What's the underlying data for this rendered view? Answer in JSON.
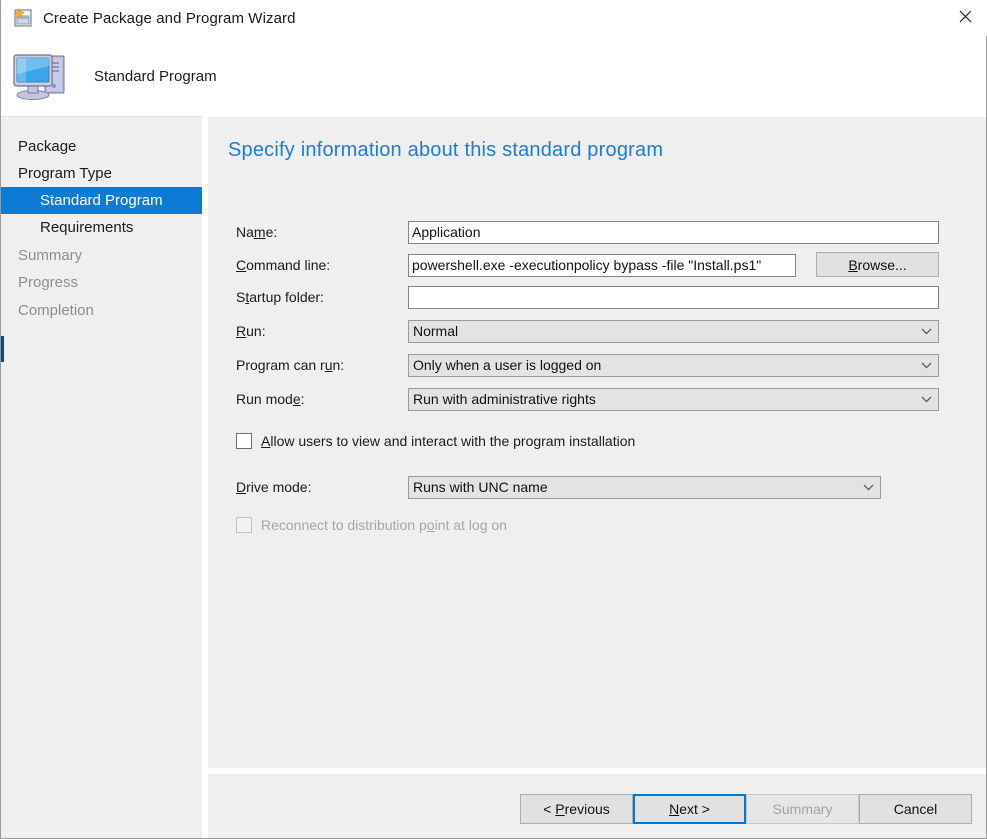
{
  "window": {
    "title": "Create Package and Program Wizard",
    "title_icon": "package-wizard-icon",
    "close_icon": "close-icon",
    "header_title": "Standard Program",
    "header_icon": "computer-monitor-icon"
  },
  "sidebar": {
    "items": [
      {
        "label": "Package",
        "level": "top",
        "state": "normal"
      },
      {
        "label": "Program Type",
        "level": "top",
        "state": "normal"
      },
      {
        "label": "Standard Program",
        "level": "sub",
        "state": "selected"
      },
      {
        "label": "Requirements",
        "level": "sub",
        "state": "normal"
      },
      {
        "label": "Summary",
        "level": "top",
        "state": "dim"
      },
      {
        "label": "Progress",
        "level": "top",
        "state": "dim"
      },
      {
        "label": "Completion",
        "level": "top",
        "state": "dim"
      }
    ]
  },
  "main": {
    "heading": "Specify information about this standard program",
    "fields": {
      "name": {
        "label": "Name:",
        "accel_index": 2,
        "value": "Application"
      },
      "command_line": {
        "label": "Command line:",
        "accel_index": 0,
        "value": "powershell.exe -executionpolicy bypass -file \"Install.ps1\"",
        "browse_label": "Browse..."
      },
      "startup_folder": {
        "label": "Startup folder:",
        "accel_index": 1,
        "value": ""
      },
      "run": {
        "label": "Run:",
        "accel_index": 0,
        "value": "Normal"
      },
      "program_can_run": {
        "label": "Program can run:",
        "accel_index": 14,
        "value": "Only when a user is logged on"
      },
      "run_mode": {
        "label": "Run mode:",
        "accel_index": 7,
        "value": "Run with administrative rights"
      },
      "drive_mode": {
        "label": "Drive mode:",
        "accel_index": 0,
        "value": "Runs with UNC name"
      }
    },
    "checkboxes": {
      "allow_interact": {
        "label": "Allow users to view and interact with the program installation",
        "checked": false,
        "enabled": true
      },
      "reconnect": {
        "label": "Reconnect to distribution point at log on",
        "checked": false,
        "enabled": false
      }
    }
  },
  "footer": {
    "previous_label": "< Previous",
    "next_label": "Next >",
    "summary_label": "Summary",
    "cancel_label": "Cancel"
  },
  "colors": {
    "accent_blue": "#0b7bd5",
    "heading_blue": "#1e7bd8",
    "focus_blue": "#0078d7",
    "panel_grey": "#efefef",
    "disabled_text": "#a0a0a0"
  }
}
